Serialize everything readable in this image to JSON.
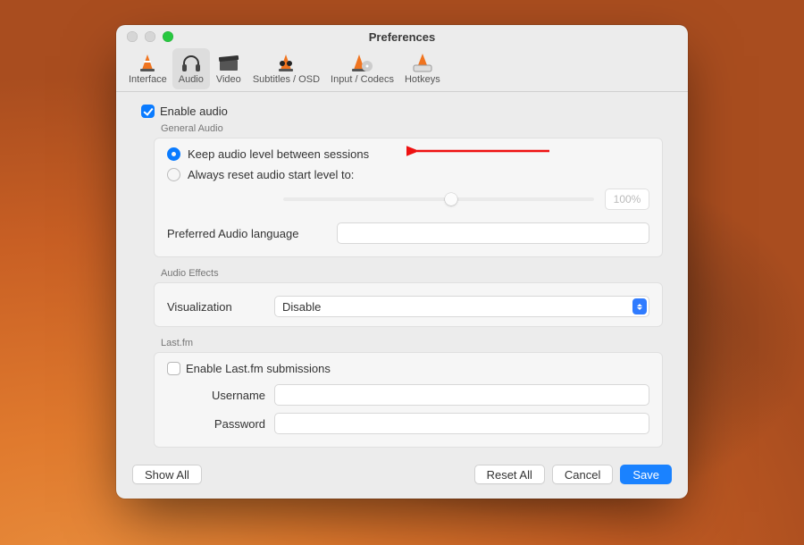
{
  "window": {
    "title": "Preferences"
  },
  "toolbar": {
    "items": [
      {
        "label": "Interface"
      },
      {
        "label": "Audio"
      },
      {
        "label": "Video"
      },
      {
        "label": "Subtitles / OSD"
      },
      {
        "label": "Input / Codecs"
      },
      {
        "label": "Hotkeys"
      }
    ],
    "selected_index": 1
  },
  "audio": {
    "enable_label": "Enable audio",
    "enable_checked": true,
    "general_section": "General Audio",
    "radio_keep": "Keep audio level between sessions",
    "radio_reset": "Always reset audio start level to:",
    "radio_selected": "keep",
    "start_level_pct": "100%",
    "pref_lang_label": "Preferred Audio language",
    "pref_lang_value": "",
    "effects_section": "Audio Effects",
    "visualization_label": "Visualization",
    "visualization_value": "Disable",
    "lastfm_section": "Last.fm",
    "lastfm_enable_label": "Enable Last.fm submissions",
    "lastfm_enable_checked": false,
    "lastfm_username_label": "Username",
    "lastfm_username_value": "",
    "lastfm_password_label": "Password",
    "lastfm_password_value": ""
  },
  "footer": {
    "show_all": "Show All",
    "reset_all": "Reset All",
    "cancel": "Cancel",
    "save": "Save"
  }
}
